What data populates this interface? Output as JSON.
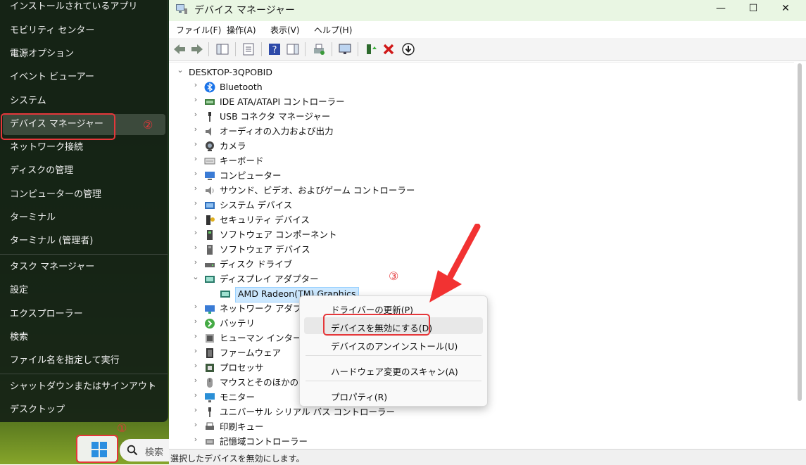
{
  "winx_menu": {
    "items": [
      {
        "label": "インストールされているアプリ"
      },
      {
        "label": "モビリティ センター"
      },
      {
        "label": "電源オプション"
      },
      {
        "label": "イベント ビューアー"
      },
      {
        "label": "システム"
      },
      {
        "label": "デバイス マネージャー"
      },
      {
        "label": "ネットワーク接続"
      },
      {
        "label": "ディスクの管理"
      },
      {
        "label": "コンピューターの管理"
      },
      {
        "label": "ターミナル"
      },
      {
        "label": "ターミナル (管理者)"
      },
      {
        "label": "タスク マネージャー"
      },
      {
        "label": "設定"
      },
      {
        "label": "エクスプローラー"
      },
      {
        "label": "検索"
      },
      {
        "label": "ファイル名を指定して実行"
      },
      {
        "label": "シャットダウンまたはサインアウト"
      },
      {
        "label": "デスクトップ"
      }
    ]
  },
  "taskbar": {
    "search_label": "検索"
  },
  "annotations": {
    "step1": "①",
    "step2": "②",
    "step3": "③"
  },
  "window": {
    "title": "デバイス マネージャー",
    "controls": {
      "minimize": "—",
      "maximize": "☐",
      "close": "✕"
    },
    "menus": [
      "ファイル(F)",
      "操作(A)",
      "表示(V)",
      "ヘルプ(H)"
    ]
  },
  "tree": {
    "root": "DESKTOP-3QPOBID",
    "nodes": [
      {
        "label": "Bluetooth",
        "icon": "bluetooth-icon"
      },
      {
        "label": "IDE ATA/ATAPI コントローラー",
        "icon": "ide-controller-icon"
      },
      {
        "label": "USB コネクタ マネージャー",
        "icon": "usb-icon"
      },
      {
        "label": "オーディオの入力および出力",
        "icon": "speaker-icon"
      },
      {
        "label": "カメラ",
        "icon": "camera-icon"
      },
      {
        "label": "キーボード",
        "icon": "keyboard-icon"
      },
      {
        "label": "コンピューター",
        "icon": "computer-icon"
      },
      {
        "label": "サウンド、ビデオ、およびゲーム コントローラー",
        "icon": "sound-icon"
      },
      {
        "label": "システム デバイス",
        "icon": "system-device-icon"
      },
      {
        "label": "セキュリティ デバイス",
        "icon": "security-device-icon"
      },
      {
        "label": "ソフトウェア コンポーネント",
        "icon": "software-component-icon"
      },
      {
        "label": "ソフトウェア デバイス",
        "icon": "software-device-icon"
      },
      {
        "label": "ディスク ドライブ",
        "icon": "disk-drive-icon"
      },
      {
        "label": "ディスプレイ アダプター",
        "icon": "display-adapter-icon"
      },
      {
        "label": "AMD Radeon(TM) Graphics",
        "icon": "display-adapter-icon"
      },
      {
        "label": "ネットワーク アダプター",
        "icon": "network-adapter-icon"
      },
      {
        "label": "バッテリ",
        "icon": "battery-icon"
      },
      {
        "label": "ヒューマン インターフェース デバイス",
        "icon": "hid-icon"
      },
      {
        "label": "ファームウェア",
        "icon": "firmware-icon"
      },
      {
        "label": "プロセッサ",
        "icon": "processor-icon"
      },
      {
        "label": "マウスとそのほかのポインティング デバイス",
        "icon": "mouse-icon"
      },
      {
        "label": "モニター",
        "icon": "monitor-icon"
      },
      {
        "label": "ユニバーサル シリアル バス コントローラー",
        "icon": "usb-controller-icon"
      },
      {
        "label": "印刷キュー",
        "icon": "printer-icon"
      },
      {
        "label": "記憶域コントローラー",
        "icon": "storage-controller-icon"
      }
    ]
  },
  "context_menu": {
    "items": [
      {
        "label": "ドライバーの更新(P)"
      },
      {
        "label": "デバイスを無効にする(D)"
      },
      {
        "label": "デバイスのアンインストール(U)"
      },
      {
        "label": "ハードウェア変更のスキャン(A)"
      },
      {
        "label": "プロパティ(R)"
      }
    ]
  },
  "statusbar": {
    "text": "選択したデバイスを無効にします。"
  },
  "colors": {
    "accent_red": "#e5373a",
    "title_bar": "#e9f6e3",
    "selection": "#cce8ff"
  }
}
